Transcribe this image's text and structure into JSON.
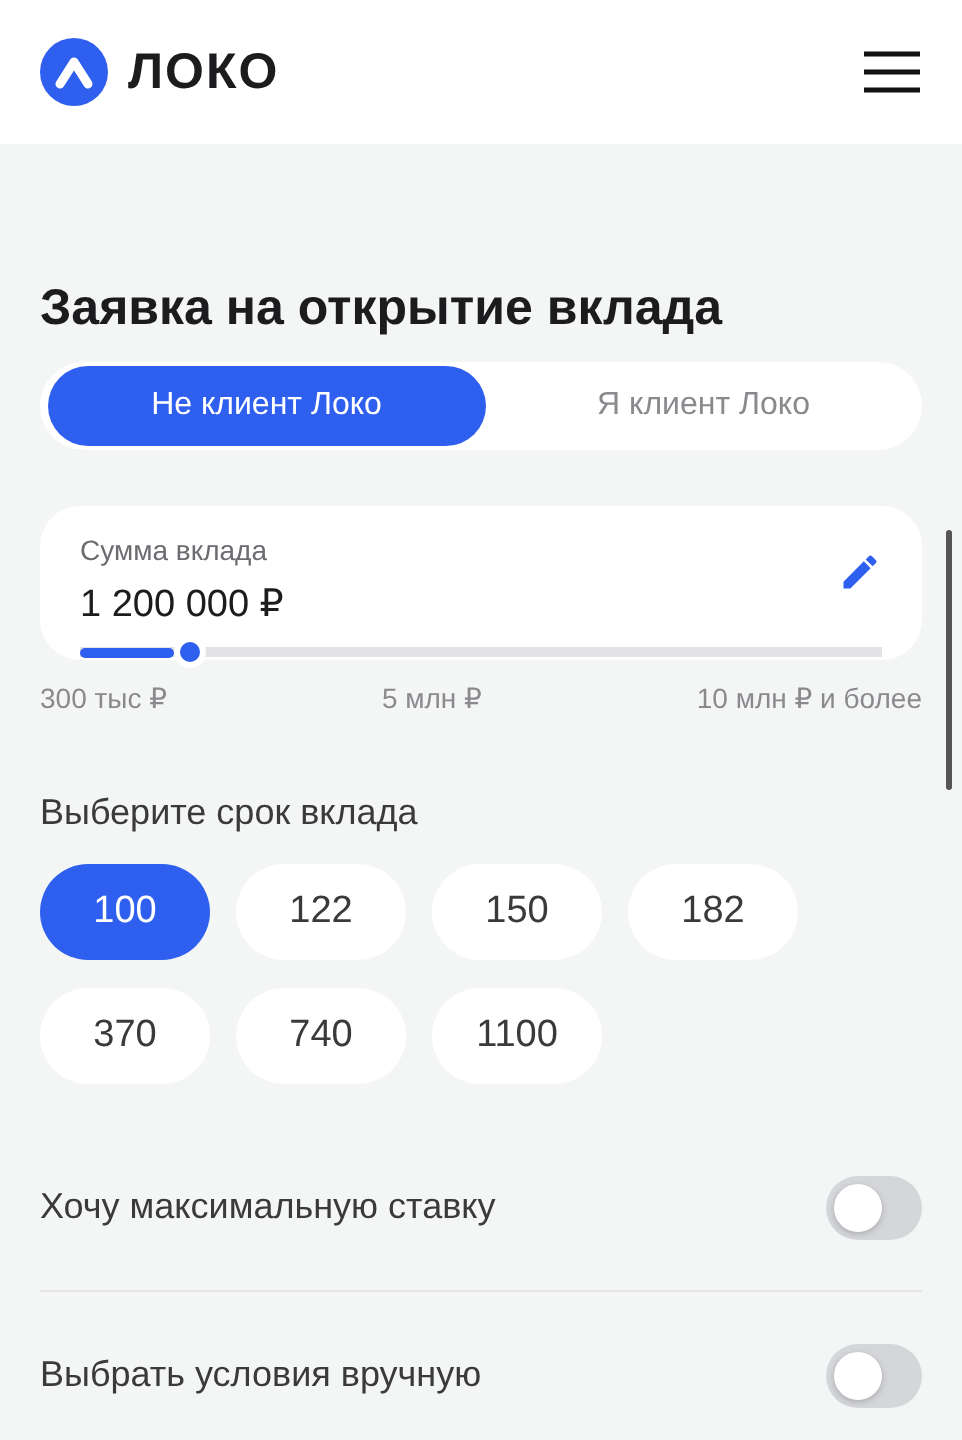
{
  "header": {
    "logo_text": "ЛОКО"
  },
  "title": "Заявка на открытие вклада",
  "client_tabs": [
    {
      "label": "Не клиент Локо",
      "selected": true
    },
    {
      "label": "Я клиент Локо",
      "selected": false
    }
  ],
  "amount": {
    "label": "Сумма вклада",
    "value": "1 200 000 ₽",
    "level": 0.117,
    "scale": [
      "300 тыс ₽",
      "5 млн ₽",
      "10 млн ₽ и более"
    ]
  },
  "term": {
    "label": "Выберите срок вклада",
    "options": [
      {
        "label": "100",
        "selected": true
      },
      {
        "label": "122",
        "selected": false
      },
      {
        "label": "150",
        "selected": false
      },
      {
        "label": "182",
        "selected": false
      },
      {
        "label": "370",
        "selected": false
      },
      {
        "label": "740",
        "selected": false
      },
      {
        "label": "1100",
        "selected": false
      }
    ]
  },
  "toggles": [
    {
      "label": "Хочу максимальную ставку",
      "on": false
    },
    {
      "label": "Выбрать условия вручную",
      "on": false
    }
  ]
}
